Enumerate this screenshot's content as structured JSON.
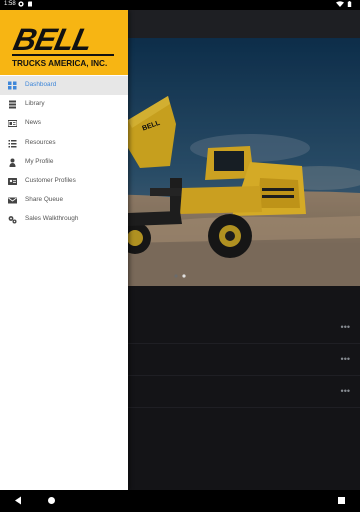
{
  "status_bar": {
    "time": "1:58"
  },
  "brand": {
    "logo_word": "BELL",
    "logo_subtitle": "TRUCKS AMERICA, INC.",
    "header_color": "#f7b513"
  },
  "menu": {
    "accent_color": "#3f87d9",
    "items": [
      {
        "label": "Dashboard",
        "icon": "grid-icon",
        "active": true
      },
      {
        "label": "Library",
        "icon": "library-icon",
        "active": false
      },
      {
        "label": "News",
        "icon": "newspaper-icon",
        "active": false
      },
      {
        "label": "Resources",
        "icon": "list-icon",
        "active": false
      },
      {
        "label": "My Profile",
        "icon": "person-icon",
        "active": false
      },
      {
        "label": "Customer Profiles",
        "icon": "contact-card-icon",
        "active": false
      },
      {
        "label": "Share Queue",
        "icon": "envelope-icon",
        "active": false
      },
      {
        "label": "Sales Walkthrough",
        "icon": "gears-icon",
        "active": false
      }
    ]
  },
  "hero": {
    "truck_label": "BELL",
    "carousel_pages": 2,
    "carousel_active_index": 1
  },
  "list": {
    "rows": 3,
    "overflow_icon": "more-horizontal-icon"
  }
}
